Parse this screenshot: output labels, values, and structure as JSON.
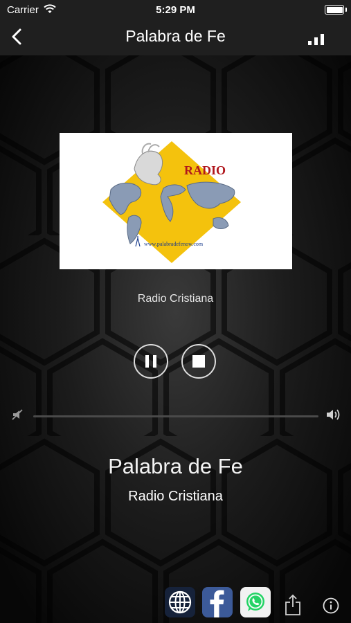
{
  "status_bar": {
    "carrier": "Carrier",
    "time": "5:29 PM"
  },
  "nav": {
    "title": "Palabra de Fe"
  },
  "station": {
    "logo_text": "RADIO",
    "logo_url_text": "www.palabradefenow.com",
    "subtitle_small": "Radio Cristiana",
    "title": "Palabra de Fe",
    "subtitle": "Radio Cristiana"
  },
  "player": {
    "volume_level": 0.0
  },
  "colors": {
    "logo_yellow": "#f4c20d",
    "logo_red": "#b0161c",
    "facebook": "#3c5a99",
    "whatsapp": "#25d366"
  },
  "icons": [
    "back-chevron-icon",
    "signal-bars-icon",
    "pause-icon",
    "stop-icon",
    "volume-mute-icon",
    "volume-max-icon",
    "globe-icon",
    "facebook-icon",
    "whatsapp-icon",
    "share-icon",
    "info-icon"
  ]
}
